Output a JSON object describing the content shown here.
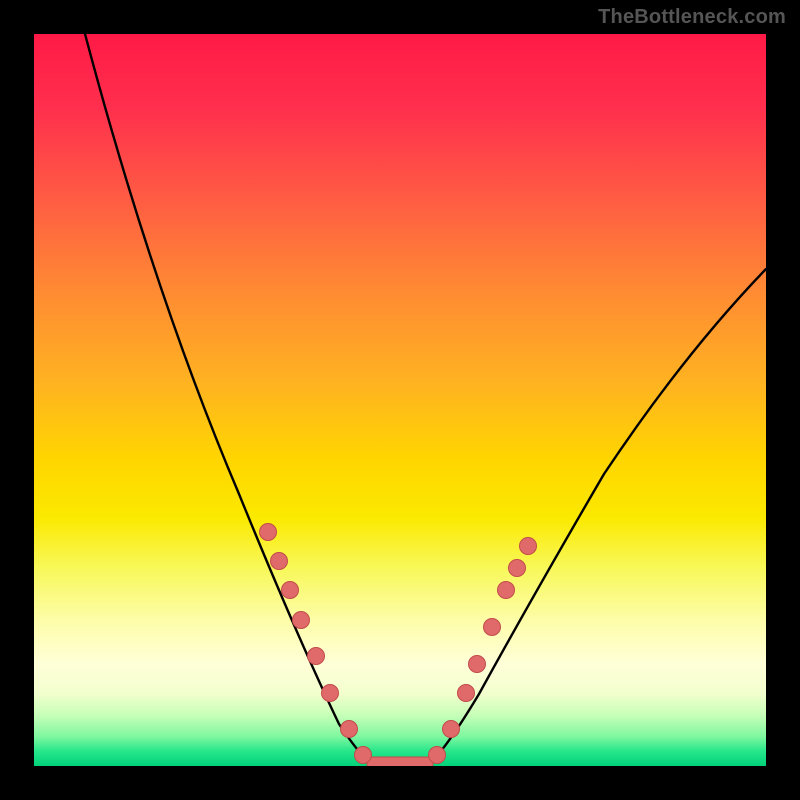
{
  "watermark": "TheBottleneck.com",
  "colors": {
    "background": "#000000",
    "curve": "#000000",
    "dot_fill": "#e06a6a",
    "dot_stroke": "#c24a4a",
    "gradient_stops": [
      "#ff1a46",
      "#ff2f4d",
      "#ff5a44",
      "#ff8a33",
      "#ffb420",
      "#ffd500",
      "#fbe900",
      "#f8f85a",
      "#fdfda8",
      "#ffffd8",
      "#f3ffce",
      "#c8ffb8",
      "#7ef7a0",
      "#26e68a",
      "#00d27a"
    ]
  },
  "chart_data": {
    "type": "line",
    "title": "",
    "xlabel": "",
    "ylabel": "",
    "xlim": [
      0,
      100
    ],
    "ylim": [
      0,
      100
    ],
    "grid": false,
    "legend": false,
    "series": [
      {
        "name": "left-branch",
        "x": [
          7,
          14,
          21,
          28,
          32,
          36,
          40,
          43,
          46
        ],
        "y": [
          99,
          79,
          61,
          43,
          32,
          22,
          12,
          5,
          0
        ]
      },
      {
        "name": "right-branch",
        "x": [
          54,
          57,
          60,
          64,
          70,
          78,
          86,
          94,
          100
        ],
        "y": [
          0,
          5,
          12,
          22,
          34,
          47,
          57,
          64,
          68
        ]
      },
      {
        "name": "flat-bottom",
        "x": [
          46,
          54
        ],
        "y": [
          0,
          0
        ]
      }
    ],
    "markers": [
      {
        "branch": "left",
        "x": 32.0,
        "y": 32
      },
      {
        "branch": "left",
        "x": 33.5,
        "y": 28
      },
      {
        "branch": "left",
        "x": 35.0,
        "y": 24
      },
      {
        "branch": "left",
        "x": 36.5,
        "y": 20
      },
      {
        "branch": "left",
        "x": 38.5,
        "y": 15
      },
      {
        "branch": "left",
        "x": 40.5,
        "y": 10
      },
      {
        "branch": "left",
        "x": 43.0,
        "y": 5
      },
      {
        "branch": "left",
        "x": 45.0,
        "y": 1.5
      },
      {
        "branch": "right",
        "x": 55.0,
        "y": 1.5
      },
      {
        "branch": "right",
        "x": 57.0,
        "y": 5
      },
      {
        "branch": "right",
        "x": 59.0,
        "y": 10
      },
      {
        "branch": "right",
        "x": 60.5,
        "y": 14
      },
      {
        "branch": "right",
        "x": 62.5,
        "y": 19
      },
      {
        "branch": "right",
        "x": 64.5,
        "y": 24
      },
      {
        "branch": "right",
        "x": 66.0,
        "y": 27
      },
      {
        "branch": "right",
        "x": 67.5,
        "y": 30
      }
    ],
    "flat_band": {
      "x_start": 46,
      "x_end": 54,
      "y": 0,
      "height": 2
    }
  }
}
